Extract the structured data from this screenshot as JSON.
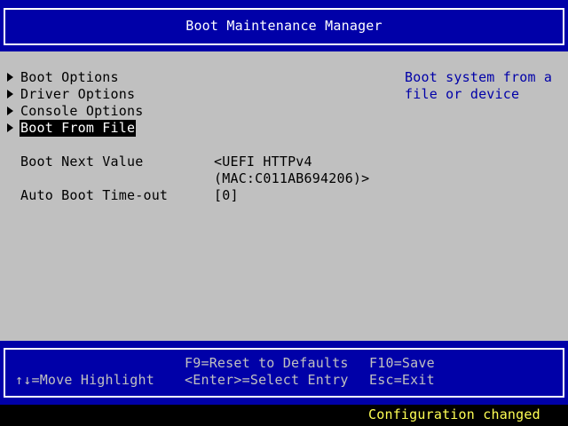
{
  "header": {
    "title": "Boot Maintenance Manager"
  },
  "menu": {
    "items": [
      {
        "label": "Boot Options"
      },
      {
        "label": "Driver Options"
      },
      {
        "label": "Console Options"
      },
      {
        "label": "Boot From File",
        "selected": true
      }
    ]
  },
  "settings": {
    "boot_next": {
      "label": "Boot Next Value",
      "value_line1": "<UEFI HTTPv4",
      "value_line2": "(MAC:C011AB694206)>"
    },
    "auto_boot": {
      "label": "Auto Boot Time-out",
      "value": "[0]"
    }
  },
  "help": {
    "text": "Boot system from a\nfile or device"
  },
  "footer": {
    "move_highlight": "↑↓=Move Highlight",
    "reset_defaults": "F9=Reset to Defaults",
    "select_entry": "<Enter>=Select Entry",
    "save": "F10=Save",
    "exit": "Esc=Exit"
  },
  "status": {
    "message": "Configuration changed"
  },
  "colors": {
    "bios_blue": "#0000a8",
    "bios_gray": "#c0c0c0",
    "status_yellow": "#ffff54",
    "selection_bg": "#000000",
    "selection_fg": "#ffffff"
  }
}
